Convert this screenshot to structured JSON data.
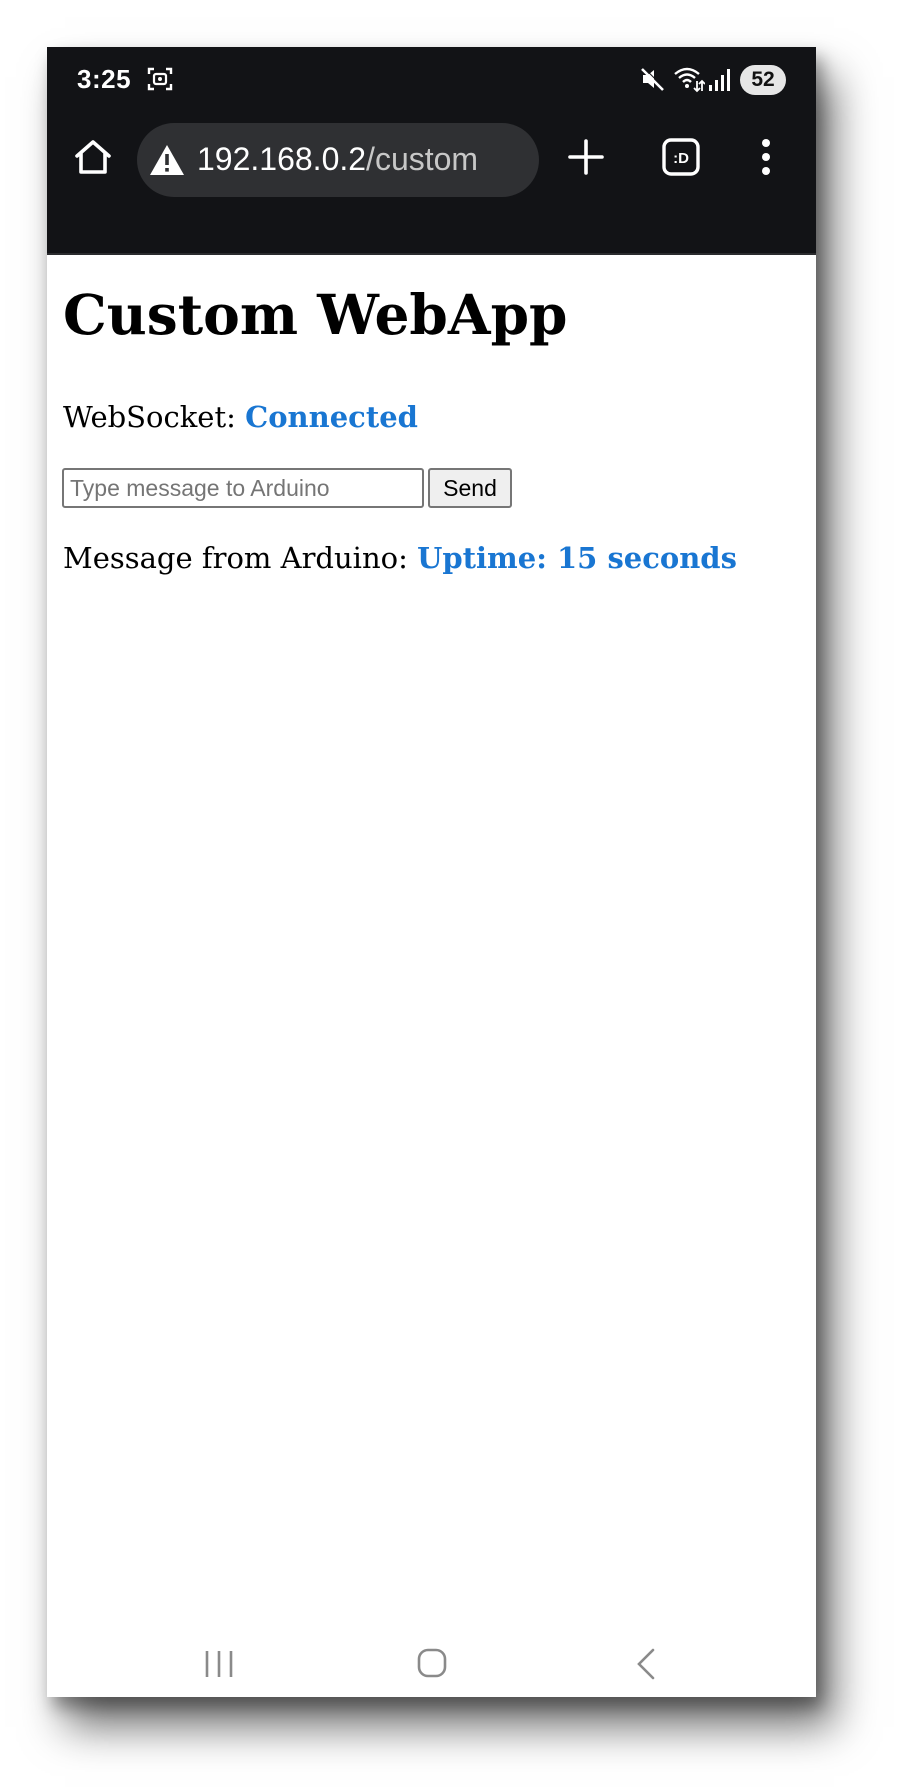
{
  "status_bar": {
    "time": "3:25",
    "battery": "52"
  },
  "browser": {
    "url_host": "192.168.0.2",
    "url_path": "/custom",
    "tabs_icon_label": ":D"
  },
  "page": {
    "title": "Custom WebApp",
    "websocket_label": "WebSocket: ",
    "websocket_status": "Connected",
    "input_placeholder": "Type message to Arduino",
    "input_value": "",
    "send_label": "Send",
    "message_label": "Message from Arduino: ",
    "message_value": "Uptime: 15 seconds"
  },
  "colors": {
    "status_blue": "#1976d2",
    "browser_bar": "#121316",
    "url_pill": "#2f3033"
  },
  "icons": {
    "screenshot": "screenshot-icon",
    "mute": "mute-icon",
    "wifi": "wifi-icon",
    "signal": "signal-icon",
    "home": "home-icon",
    "warning": "warning-icon",
    "new_tab": "plus-icon",
    "tabs": "tab-switcher-icon",
    "menu": "more-vert-icon",
    "recents": "recents-icon",
    "home_nav": "home-nav-icon",
    "back": "back-icon"
  }
}
